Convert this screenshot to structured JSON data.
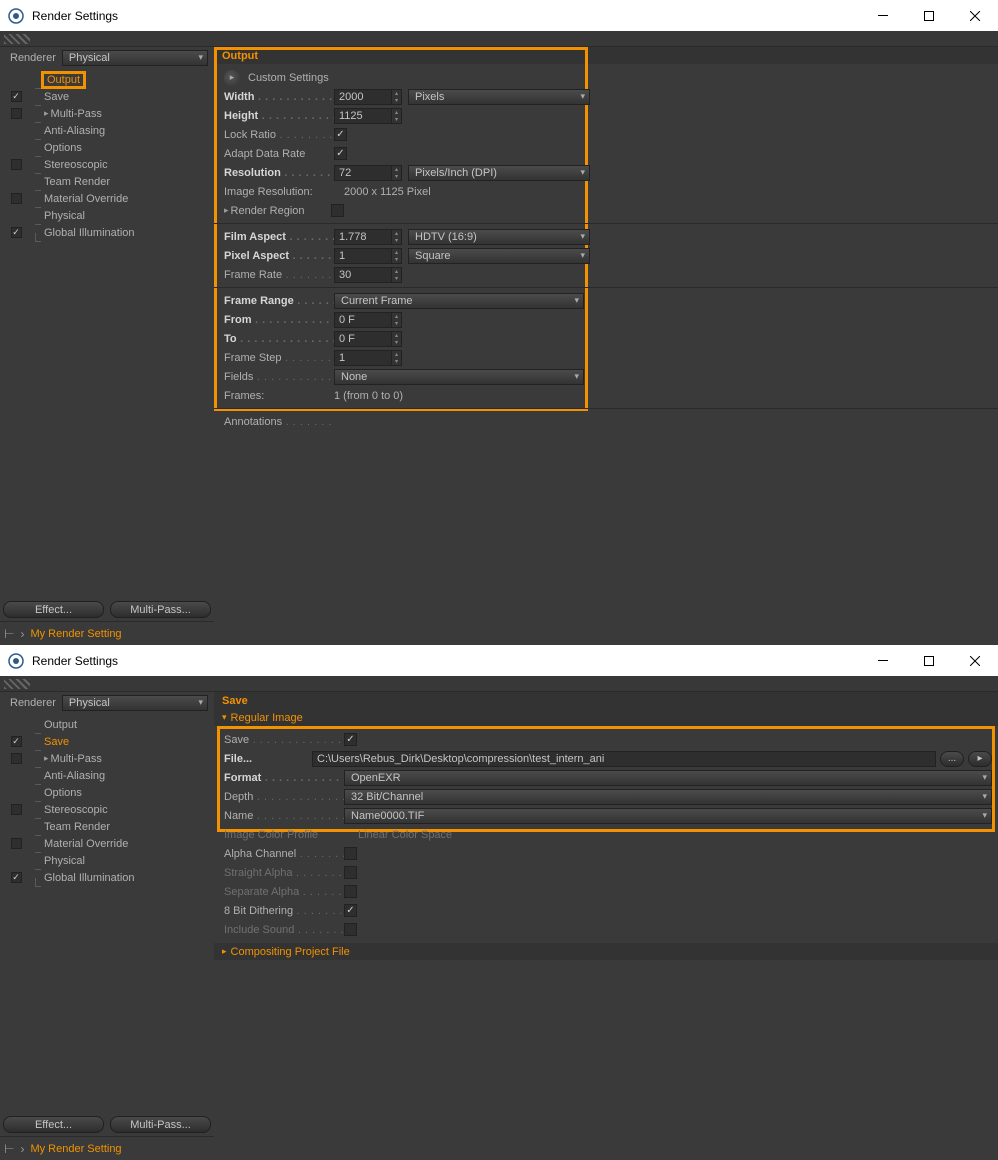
{
  "win1": {
    "title": "Render Settings",
    "renderer_label": "Renderer",
    "renderer_value": "Physical",
    "tree": [
      {
        "label": "Output",
        "check": null,
        "selected": true,
        "boxed": true
      },
      {
        "label": "Save",
        "check": true
      },
      {
        "label": "Multi-Pass",
        "check": false,
        "expand": true
      },
      {
        "label": "Anti-Aliasing",
        "check": null
      },
      {
        "label": "Options",
        "check": null
      },
      {
        "label": "Stereoscopic",
        "check": false
      },
      {
        "label": "Team Render",
        "check": null
      },
      {
        "label": "Material Override",
        "check": false
      },
      {
        "label": "Physical",
        "check": null
      },
      {
        "label": "Global Illumination",
        "check": true,
        "end": true
      }
    ],
    "effect_btn": "Effect...",
    "multipass_btn": "Multi-Pass...",
    "footer": "My Render Setting",
    "panel_title": "Output",
    "custom_settings": "Custom Settings",
    "rows": {
      "width_l": "Width",
      "width_v": "2000",
      "width_u": "Pixels",
      "height_l": "Height",
      "height_v": "1125",
      "lock_l": "Lock Ratio",
      "lock_v": true,
      "adapt_l": "Adapt Data Rate",
      "adapt_v": true,
      "res_l": "Resolution",
      "res_v": "72",
      "res_u": "Pixels/Inch (DPI)",
      "imgres_l": "Image Resolution:",
      "imgres_v": "2000 x 1125 Pixel",
      "region_l": "Render Region",
      "region_v": false,
      "film_l": "Film Aspect",
      "film_v": "1.778",
      "film_u": "HDTV (16:9)",
      "pix_l": "Pixel Aspect",
      "pix_v": "1",
      "pix_u": "Square",
      "fps_l": "Frame Rate",
      "fps_v": "30",
      "range_l": "Frame Range",
      "range_u": "Current Frame",
      "from_l": "From",
      "from_v": "0 F",
      "to_l": "To",
      "to_v": "0 F",
      "step_l": "Frame Step",
      "step_v": "1",
      "fields_l": "Fields",
      "fields_u": "None",
      "frames_l": "Frames:",
      "frames_v": "1 (from 0 to 0)",
      "ann_l": "Annotations"
    }
  },
  "win2": {
    "title": "Render Settings",
    "renderer_label": "Renderer",
    "renderer_value": "Physical",
    "tree": [
      {
        "label": "Output",
        "check": null
      },
      {
        "label": "Save",
        "check": true,
        "selected": true
      },
      {
        "label": "Multi-Pass",
        "check": false,
        "expand": true
      },
      {
        "label": "Anti-Aliasing",
        "check": null
      },
      {
        "label": "Options",
        "check": null
      },
      {
        "label": "Stereoscopic",
        "check": false
      },
      {
        "label": "Team Render",
        "check": null
      },
      {
        "label": "Material Override",
        "check": false
      },
      {
        "label": "Physical",
        "check": null
      },
      {
        "label": "Global Illumination",
        "check": true,
        "end": true
      }
    ],
    "effect_btn": "Effect...",
    "multipass_btn": "Multi-Pass...",
    "footer": "My Render Setting",
    "panel_title": "Save",
    "section1": "Regular Image",
    "section2": "Compositing Project File",
    "rows": {
      "save_l": "Save",
      "save_v": true,
      "file_l": "File...",
      "file_v": "C:\\Users\\Rebus_Dirk\\Desktop\\compression\\test_intern_ani",
      "file_btn": "...",
      "fmt_l": "Format",
      "fmt_v": "OpenEXR",
      "depth_l": "Depth",
      "depth_v": "32 Bit/Channel",
      "name_l": "Name",
      "name_v": "Name0000.TIF",
      "icp_l": "Image Color Profile",
      "icp_v": "Linear Color Space",
      "alpha_l": "Alpha Channel",
      "alpha_v": false,
      "salpha_l": "Straight Alpha",
      "salpha_v": false,
      "sepa_l": "Separate Alpha",
      "sepa_v": false,
      "dith_l": "8 Bit Dithering",
      "dith_v": true,
      "snd_l": "Include Sound",
      "snd_v": false
    }
  }
}
